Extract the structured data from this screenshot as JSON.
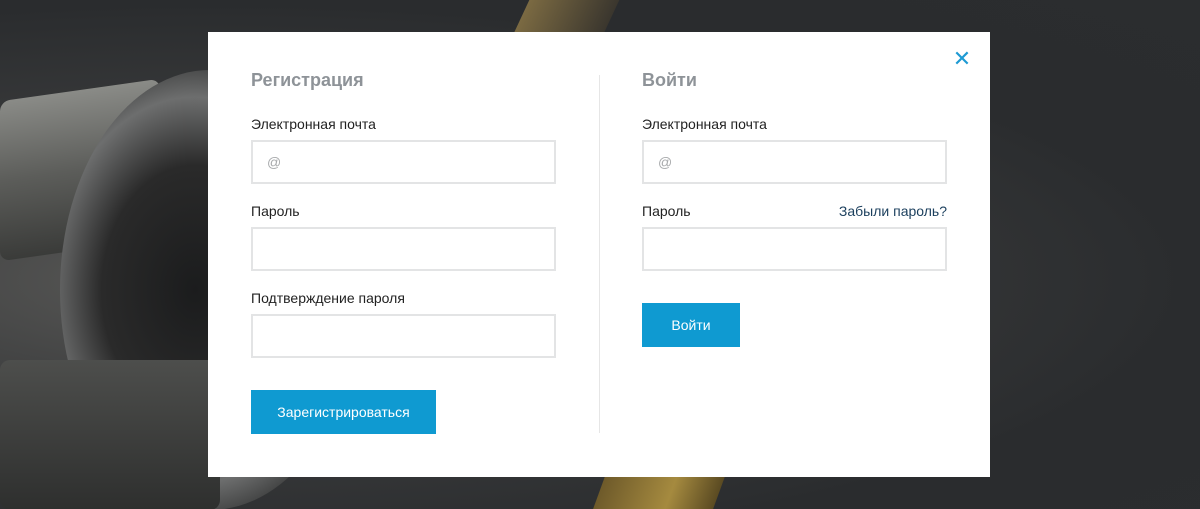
{
  "register": {
    "title": "Регистрация",
    "email_label": "Электронная почта",
    "email_placeholder": "@",
    "password_label": "Пароль",
    "confirm_label": "Подтверждение пароля",
    "submit_label": "Зарегистрироваться"
  },
  "login": {
    "title": "Войти",
    "email_label": "Электронная почта",
    "email_placeholder": "@",
    "password_label": "Пароль",
    "forgot_label": "Забыли пароль?",
    "submit_label": "Войти"
  },
  "close_icon": "close-icon",
  "colors": {
    "accent": "#0f9ad1",
    "heading": "#8e9398",
    "link": "#1b3f5d",
    "border": "#e3e4e5"
  }
}
